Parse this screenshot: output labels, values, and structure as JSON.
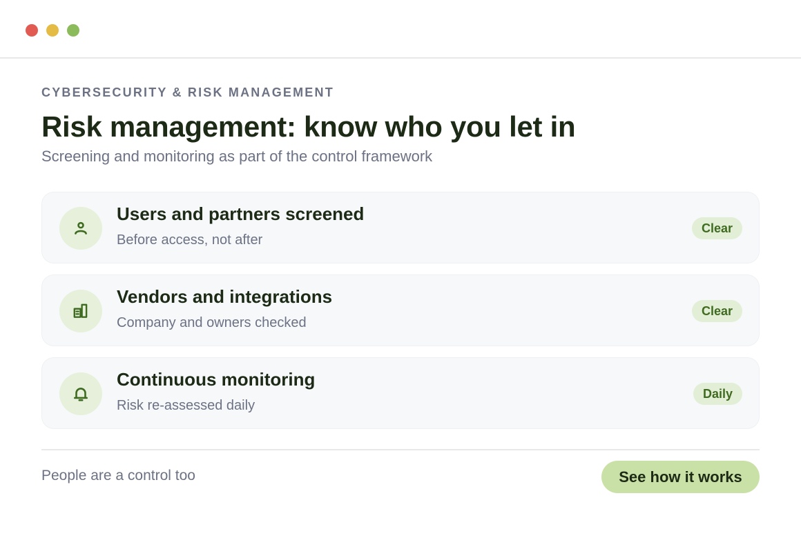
{
  "window": {
    "controls": [
      "close",
      "minimize",
      "maximize"
    ]
  },
  "header": {
    "eyebrow": "CYBERSECURITY & RISK MANAGEMENT",
    "title": "Risk management: know who you let in",
    "subtitle": "Screening and monitoring as part of the control framework"
  },
  "items": [
    {
      "icon": "user-icon",
      "title": "Users and partners screened",
      "subtitle": "Before access, not after",
      "badge": "Clear"
    },
    {
      "icon": "building-icon",
      "title": "Vendors and integrations",
      "subtitle": "Company and owners checked",
      "badge": "Clear"
    },
    {
      "icon": "bell-icon",
      "title": "Continuous monitoring",
      "subtitle": "Risk re-assessed daily",
      "badge": "Daily"
    }
  ],
  "footer": {
    "note": "People are a control too",
    "cta_label": "See how it works"
  },
  "colors": {
    "accent": "#3f6b21",
    "badge_bg": "#e3eed6",
    "cta_bg": "#c9e1a6",
    "heading": "#1c2a16",
    "muted": "#6c7283"
  }
}
